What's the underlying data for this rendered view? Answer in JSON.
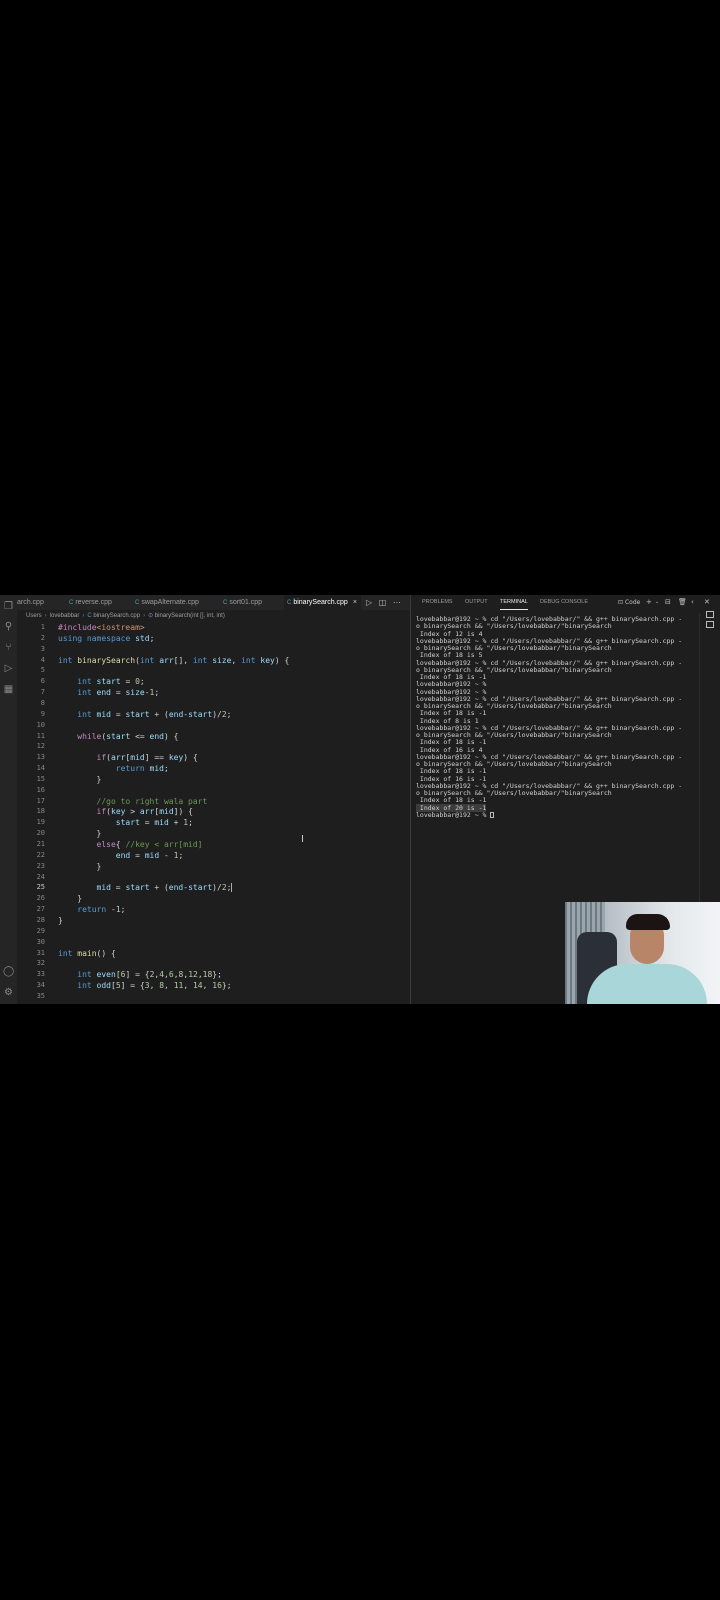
{
  "editor": {
    "tabs": [
      {
        "label": "arch.cpp",
        "active": false
      },
      {
        "label": "reverse.cpp",
        "active": false
      },
      {
        "label": "swapAlternate.cpp",
        "active": false
      },
      {
        "label": "sort01.cpp",
        "active": false
      },
      {
        "label": "binarySearch.cpp",
        "active": true
      }
    ],
    "tab_glyph": "C",
    "close_glyph": "×",
    "breadcrumb": [
      "Users",
      "lovebabbar",
      "binarySearch.cpp",
      "binarySearch(int [], int, int)"
    ],
    "current_line": 25,
    "lines": [
      "#include<iostream>",
      "using namespace std;",
      "",
      "int binarySearch(int arr[], int size, int key) {",
      "",
      "    int start = 0;",
      "    int end = size-1;",
      "",
      "    int mid = start + (end-start)/2;",
      "",
      "    while(start <= end) {",
      "",
      "        if(arr[mid] == key) {",
      "            return mid;",
      "        }",
      "",
      "        //go to right wala part",
      "        if(key > arr[mid]) {",
      "            start = mid + 1;",
      "        }",
      "        else{ //key < arr[mid]",
      "            end = mid - 1;",
      "        }",
      "",
      "        mid = start + (end-start)/2;",
      "    }",
      "    return -1;",
      "}",
      "",
      "",
      "int main() {",
      "",
      "    int even[6] = {2,4,6,8,12,18};",
      "    int odd[5] = {3, 8, 11, 14, 16};",
      ""
    ]
  },
  "panel": {
    "tabs": [
      "PROBLEMS",
      "OUTPUT",
      "TERMINAL",
      "DEBUG CONSOLE"
    ],
    "active_tab": "TERMINAL",
    "shell_label": "Code",
    "terminal_lines": [
      "lovebabbar@192 ~ % cd \"/Users/lovebabbar/\" && g++ binarySearch.cpp -",
      "o binarySearch && \"/Users/lovebabbar/\"binarySearch",
      " Index of 12 is 4",
      "lovebabbar@192 ~ % cd \"/Users/lovebabbar/\" && g++ binarySearch.cpp -",
      "o binarySearch && \"/Users/lovebabbar/\"binarySearch",
      " Index of 18 is 5",
      "lovebabbar@192 ~ % cd \"/Users/lovebabbar/\" && g++ binarySearch.cpp -",
      "o binarySearch && \"/Users/lovebabbar/\"binarySearch",
      " Index of 18 is -1",
      "lovebabbar@192 ~ %",
      "lovebabbar@192 ~ %",
      "lovebabbar@192 ~ % cd \"/Users/lovebabbar/\" && g++ binarySearch.cpp -",
      "o binarySearch && \"/Users/lovebabbar/\"binarySearch",
      " Index of 18 is -1",
      " Index of 8 is 1",
      "lovebabbar@192 ~ % cd \"/Users/lovebabbar/\" && g++ binarySearch.cpp -",
      "o binarySearch && \"/Users/lovebabbar/\"binarySearch",
      " Index of 18 is -1",
      " Index of 16 is 4",
      "lovebabbar@192 ~ % cd \"/Users/lovebabbar/\" && g++ binarySearch.cpp -",
      "o binarySearch && \"/Users/lovebabbar/\"binarySearch",
      " Index of 18 is -1",
      " Index of 16 is -1",
      "lovebabbar@192 ~ % cd \"/Users/lovebabbar/\" && g++ binarySearch.cpp -",
      "o binarySearch && \"/Users/lovebabbar/\"binarySearch",
      " Index of 18 is -1",
      " Index of 20 is -1",
      "lovebabbar@192 ~ % "
    ],
    "highlighted_line": 26
  },
  "colors": {
    "keyword": "#569cd6",
    "control": "#c586c0",
    "function": "#dcdcaa",
    "number": "#b5cea8",
    "string": "#ce9178",
    "comment": "#6a9955",
    "variable": "#9cdcfe",
    "text": "#d4d4d4"
  },
  "icons": {
    "activity_bar": [
      "files-icon",
      "search-icon",
      "source-control-icon",
      "run-debug-icon",
      "extensions-icon",
      "account-icon",
      "settings-gear-icon"
    ]
  }
}
